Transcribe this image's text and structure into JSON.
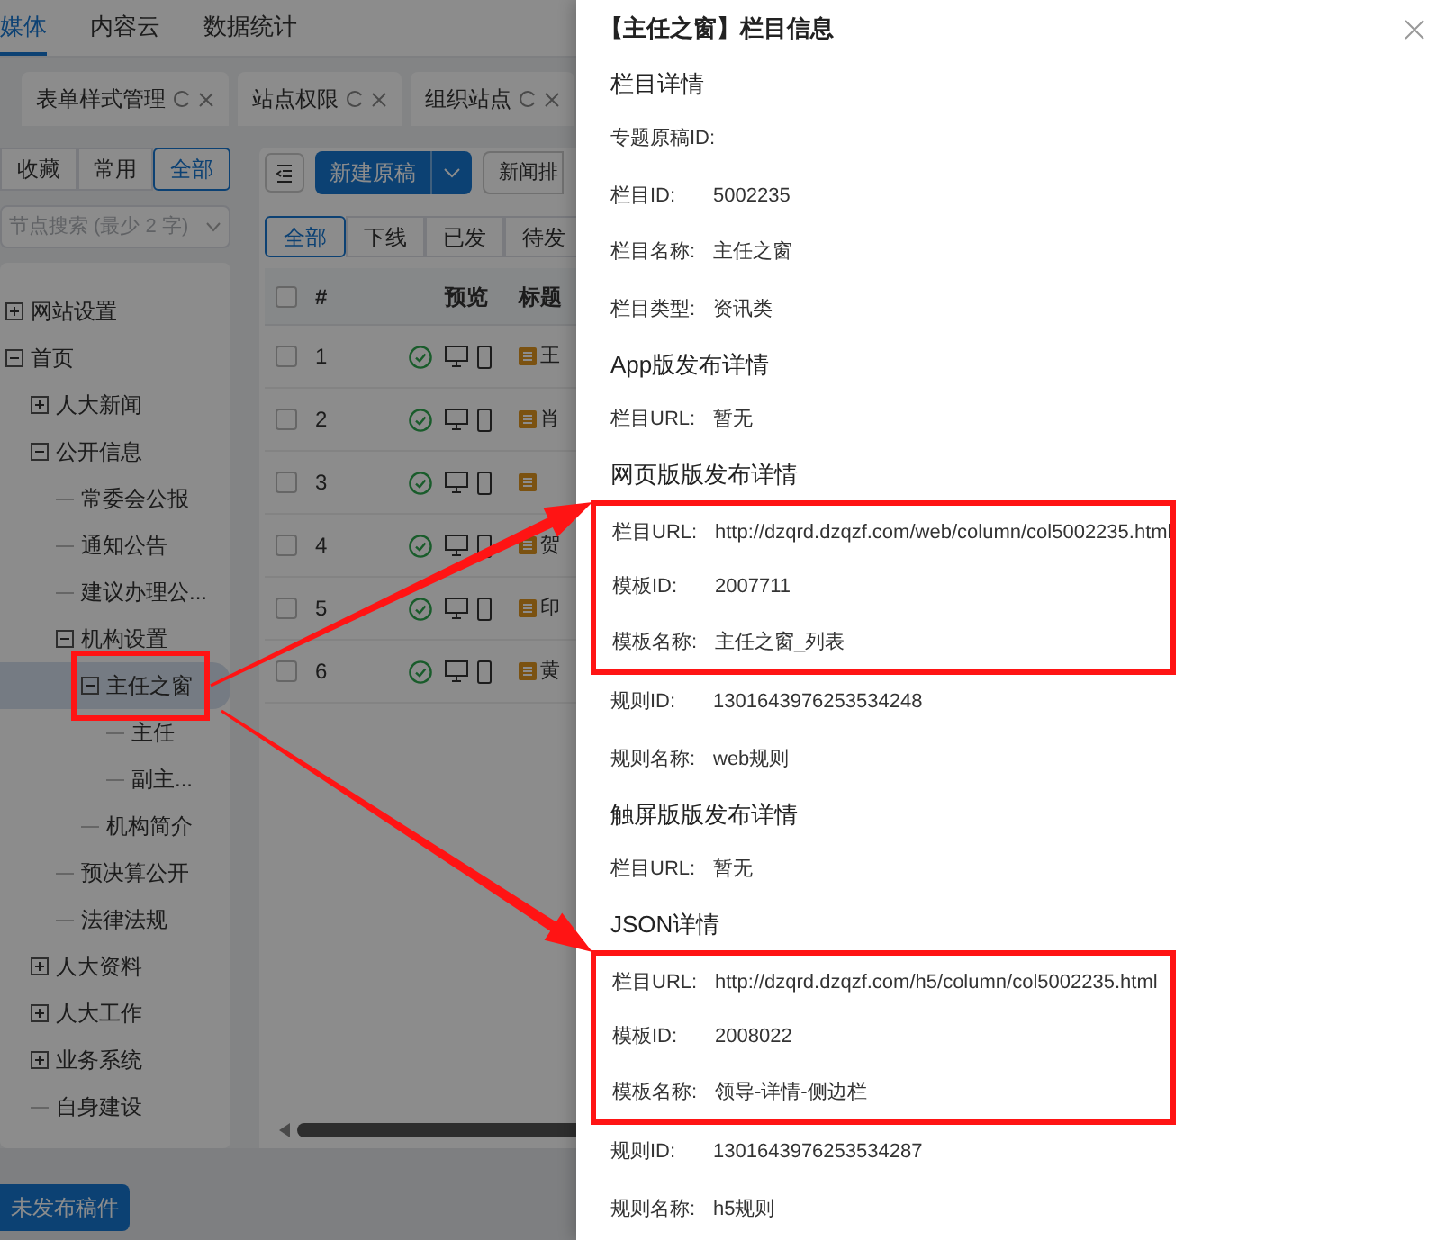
{
  "top_nav": [
    {
      "label": "媒体",
      "selected": true
    },
    {
      "label": "内容云",
      "selected": false
    },
    {
      "label": "数据统计",
      "selected": false
    }
  ],
  "page_tabs": [
    {
      "label": "表单样式管理"
    },
    {
      "label": "站点权限"
    },
    {
      "label": "组织站点"
    }
  ],
  "sidebar": {
    "filters": [
      {
        "label": "收藏",
        "selected": false
      },
      {
        "label": "常用",
        "selected": false
      },
      {
        "label": "全部",
        "selected": true
      }
    ],
    "search": {
      "placeholder": "节点搜索 (最少 2 字)"
    },
    "tree": [
      {
        "label": "网站设置",
        "expanded": false,
        "selected": false,
        "highlighted": false
      },
      {
        "label": "首页",
        "expanded": true,
        "selected": false,
        "highlighted": false,
        "children": [
          {
            "label": "人大新闻",
            "expanded": false,
            "selected": false,
            "highlighted": false
          },
          {
            "label": "公开信息",
            "expanded": true,
            "selected": false,
            "highlighted": false,
            "children": [
              {
                "label": "常委会公报",
                "selected": false,
                "highlighted": false
              },
              {
                "label": "通知公告",
                "selected": false,
                "highlighted": false
              },
              {
                "label": "建议办理公...",
                "selected": false,
                "highlighted": false
              },
              {
                "label": "机构设置",
                "expanded": true,
                "selected": false,
                "highlighted": false,
                "children": [
                  {
                    "label": "主任之窗",
                    "expanded": true,
                    "selected": true,
                    "highlighted": true,
                    "children": [
                      {
                        "label": "主任",
                        "selected": false,
                        "highlighted": false
                      },
                      {
                        "label": "副主...",
                        "selected": false,
                        "highlighted": false
                      }
                    ]
                  },
                  {
                    "label": "机构简介",
                    "selected": false,
                    "highlighted": false
                  }
                ]
              },
              {
                "label": "预决算公开",
                "selected": false,
                "highlighted": false
              },
              {
                "label": "法律法规",
                "selected": false,
                "highlighted": false
              }
            ]
          },
          {
            "label": "人大资料",
            "expanded": false,
            "selected": false,
            "highlighted": false
          },
          {
            "label": "人大工作",
            "expanded": false,
            "selected": false,
            "highlighted": false
          },
          {
            "label": "业务系统",
            "expanded": false,
            "selected": false,
            "highlighted": false
          },
          {
            "label": "自身建设",
            "selected": false,
            "highlighted": false
          }
        ]
      }
    ]
  },
  "toolbar": {
    "new_button": "新建原稿",
    "sort_button": "新闻排"
  },
  "status_tabs": [
    {
      "label": "全部",
      "selected": true
    },
    {
      "label": "下线",
      "selected": false
    },
    {
      "label": "已发",
      "selected": false
    },
    {
      "label": "待发",
      "selected": false
    }
  ],
  "table": {
    "columns": [
      "#",
      "预览",
      "标题"
    ],
    "all_checked": false,
    "rows": [
      {
        "number": "1",
        "title": "王",
        "checked": false
      },
      {
        "number": "2",
        "title": "肖",
        "checked": false
      },
      {
        "number": "3",
        "checked": false
      },
      {
        "number": "4",
        "title": "贺",
        "checked": false
      },
      {
        "number": "5",
        "title": "印",
        "checked": false
      },
      {
        "number": "6",
        "title": "黄",
        "checked": false
      }
    ]
  },
  "footer_button": "未发布稿件",
  "drawer": {
    "title": "【主任之窗】栏目信息",
    "sections": [
      {
        "heading": "栏目详情",
        "fields": [
          {
            "label": "专题原稿ID:",
            "highlighted": false
          },
          {
            "label": "栏目ID:",
            "value": "5002235",
            "highlighted": false
          },
          {
            "label": "栏目名称:",
            "value": "主任之窗",
            "highlighted": false
          },
          {
            "label": "栏目类型:",
            "value": "资讯类",
            "highlighted": false
          }
        ]
      },
      {
        "heading": "App版发布详情",
        "fields": [
          {
            "label": "栏目URL:",
            "value": "暂无",
            "highlighted": false
          }
        ]
      },
      {
        "heading": "网页版版发布详情",
        "fields": [
          {
            "label": "栏目URL:",
            "value": "http://dzqrd.dzqzf.com/web/column/col5002235.html",
            "highlighted": true
          },
          {
            "label": "模板ID:",
            "value": "2007711",
            "highlighted": true
          },
          {
            "label": "模板名称:",
            "value": "主任之窗_列表",
            "highlighted": true
          },
          {
            "label": "规则ID:",
            "value": "1301643976253534248",
            "highlighted": false
          },
          {
            "label": "规则名称:",
            "value": "web规则",
            "highlighted": false
          }
        ]
      },
      {
        "heading": "触屏版版发布详情",
        "fields": [
          {
            "label": "栏目URL:",
            "value": "暂无",
            "highlighted": false
          }
        ]
      },
      {
        "heading": "JSON详情",
        "fields": [
          {
            "label": "栏目URL:",
            "value": "http://dzqrd.dzqzf.com/h5/column/col5002235.html",
            "highlighted": true
          },
          {
            "label": "模板ID:",
            "value": "2008022",
            "highlighted": true
          },
          {
            "label": "模板名称:",
            "value": "领导-详情-侧边栏",
            "highlighted": true
          },
          {
            "label": "规则ID:",
            "value": "1301643976253534287",
            "highlighted": false
          },
          {
            "label": "规则名称:",
            "value": "h5规则",
            "highlighted": false
          }
        ]
      }
    ]
  }
}
